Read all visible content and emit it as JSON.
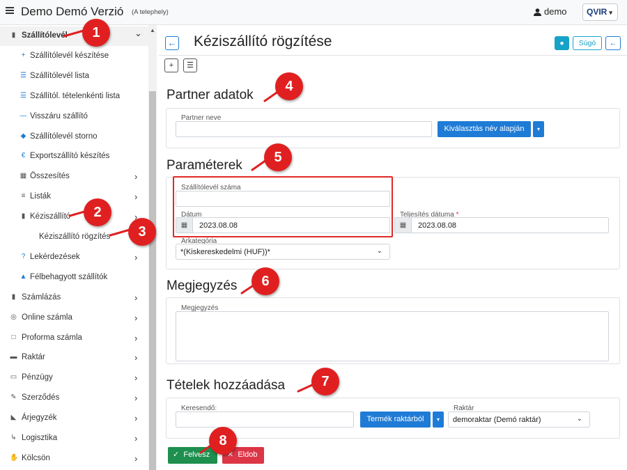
{
  "app": {
    "title": "Demo Demó Verzió",
    "subtitle": "(A telephely)",
    "user": "demo",
    "logo": "QVIR"
  },
  "sidebar": {
    "items": [
      {
        "label": "Szállítólevél",
        "icon": "file-icon",
        "level": 1,
        "chevron": "⌄"
      },
      {
        "label": "Szállítólevél készítése",
        "icon": "plus-icon",
        "level": 2
      },
      {
        "label": "Szállítólevél lista",
        "icon": "list-icon",
        "level": 2
      },
      {
        "label": "Szállítól. tételenkénti lista",
        "icon": "list-icon",
        "level": 2
      },
      {
        "label": "Visszáru szállító",
        "icon": "minus-icon",
        "level": 2
      },
      {
        "label": "Szállítólevél storno",
        "icon": "eraser-icon",
        "level": 2
      },
      {
        "label": "Exportszállító készítés",
        "icon": "euro-icon",
        "level": 2
      },
      {
        "label": "Összesítés",
        "icon": "calculator-icon",
        "level": 2,
        "chevron": "›"
      },
      {
        "label": "Listák",
        "icon": "lines-icon",
        "level": 2,
        "chevron": "›"
      },
      {
        "label": "Kéziszállító",
        "icon": "file-icon",
        "level": 2,
        "chevron": "›"
      },
      {
        "label": "Kéziszállító rögzítés",
        "level": 3
      },
      {
        "label": "Lekérdezések",
        "icon": "question-icon",
        "level": 2,
        "chevron": "›"
      },
      {
        "label": "Félbehagyott szállítók",
        "icon": "unlock-icon",
        "level": 2
      },
      {
        "label": "Számlázás",
        "icon": "file-icon",
        "level": 1,
        "chevron": "›"
      },
      {
        "label": "Online számla",
        "icon": "globe-icon",
        "level": 1,
        "chevron": "›"
      },
      {
        "label": "Proforma számla",
        "icon": "square-icon",
        "level": 1,
        "chevron": "›"
      },
      {
        "label": "Raktár",
        "icon": "warehouse-icon",
        "level": 1,
        "chevron": "›"
      },
      {
        "label": "Pénzügy",
        "icon": "money-icon",
        "level": 1,
        "chevron": "›"
      },
      {
        "label": "Szerződés",
        "icon": "signature-icon",
        "level": 1,
        "chevron": "›"
      },
      {
        "label": "Árjegyzék",
        "icon": "tag-icon",
        "level": 1,
        "chevron": "›"
      },
      {
        "label": "Logisztika",
        "icon": "dolly-icon",
        "level": 1,
        "chevron": "›"
      },
      {
        "label": "Kölcsön",
        "icon": "hand-icon",
        "level": 1,
        "chevron": "›"
      }
    ]
  },
  "page": {
    "title": "Kéziszállító rögzítése",
    "help_label": "Súgó"
  },
  "partner": {
    "heading": "Partner adatok",
    "name_label": "Partner neve",
    "name_value": "",
    "select_button": "Kiválasztás név alapján"
  },
  "params": {
    "heading": "Paraméterek",
    "number_label": "Szállítólevél száma",
    "number_value": "",
    "date_label": "Dátum",
    "date_value": "2023.08.08",
    "fulfil_label": "Teljesítés dátuma",
    "required_mark": "*",
    "fulfil_value": "2023.08.08",
    "price_label": "Árkategória",
    "price_value": "*(Kiskereskedelmi (HUF))*"
  },
  "note": {
    "heading": "Megjegyzés",
    "label": "Megjegyzés",
    "value": ""
  },
  "items": {
    "heading": "Tételek hozzáadása",
    "search_label": "Keresendő:",
    "search_value": "",
    "product_button": "Termék raktárból",
    "warehouse_label": "Raktár",
    "warehouse_value": "demoraktar (Demó raktár)"
  },
  "actions": {
    "save": "Felvesz",
    "discard": "Eldob"
  },
  "badges": [
    "1",
    "2",
    "3",
    "4",
    "5",
    "6",
    "7",
    "8"
  ],
  "colors": {
    "primary": "#1e7bd6",
    "success": "#1e8f4e",
    "danger": "#dc3545",
    "badge": "#e02020",
    "teal": "#17a2c8"
  }
}
